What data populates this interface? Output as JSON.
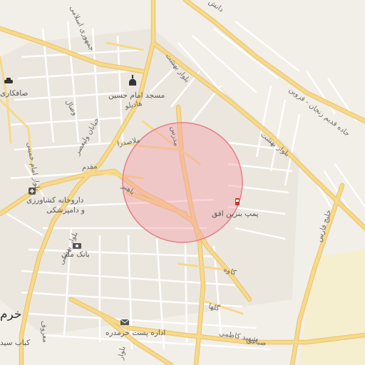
{
  "map": {
    "roads": {
      "north_road": "دانش",
      "rail_road": "جاده قدیم زنجان - قزوین",
      "beheshti_east": "بلوار بهشت",
      "beheshti_north": "بلوار بهشت",
      "jomhouri": "جمهوری اسلامی",
      "keshavarz": "خیابان ولیعصر",
      "vesal": "وصال",
      "hadi": "هادیلو",
      "molla_sadra": "ملاصدرا",
      "moghadam": "مقدم",
      "bahonar": "باهنر",
      "modares": "مدرس",
      "imam_khomeini": "بلوار امام خمینی",
      "beheshti_sw": "بلوار بهشتی",
      "khalij_fars": "خلیج فارس",
      "kaveh": "کاوه",
      "gol_ha": "گلها",
      "shahid_kazemi": "شهید کاظمی",
      "sabbaghi": "صباغی",
      "maroof": "معروف",
      "bolvar_s": "بلوار"
    },
    "pois": {
      "mosque": "مسجد امام حسین",
      "gas_station": "پمپ بنزین افق",
      "pharmacy_line1": "داروخانه کشاورزی",
      "pharmacy_line2": "و دامپزشکی",
      "bank": "بانک ملی",
      "post_office": "اداره پست خرمدره",
      "car_service": "صافکاری",
      "kebab": "کباب سید",
      "city": "خرم"
    },
    "colors": {
      "background": "#f2efe9",
      "major_road": "#f7d98a",
      "major_road_casing": "#e8c26a",
      "minor_road": "#ffffff",
      "park": "#cfe8c8",
      "industrial": "#f5efd0",
      "highlight_fill": "#f4a0a8",
      "highlight_stroke": "#e77d88"
    },
    "icons": {
      "mosque": "mosque-icon",
      "gas_station": "fuel-icon",
      "pharmacy": "pharmacy-icon",
      "bank": "bank-icon",
      "post_office": "mail-icon",
      "car_service": "car-icon"
    }
  }
}
